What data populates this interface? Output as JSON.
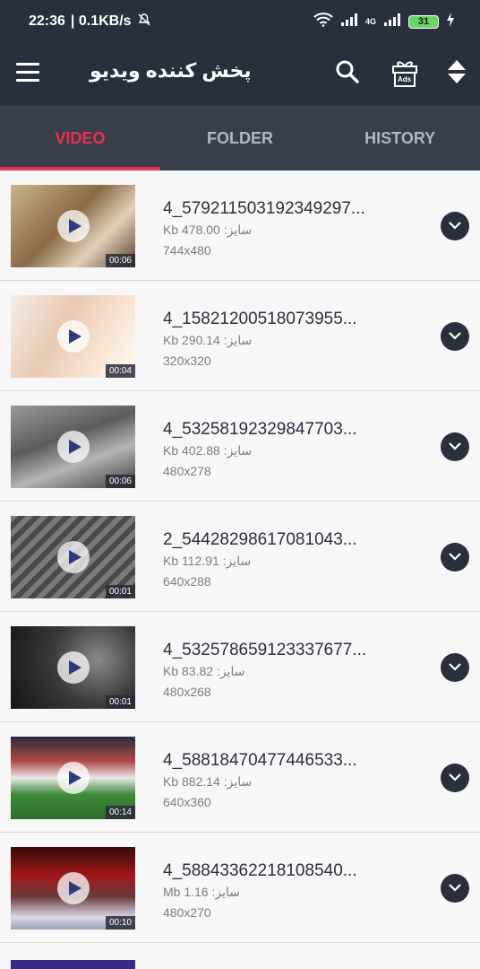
{
  "status_bar": {
    "time": "22:36",
    "speed": "| 0.1KB/s",
    "signal_label": "4G",
    "battery": "31"
  },
  "toolbar": {
    "title": "پخش کننده ویدیو",
    "ads_label": "Ads"
  },
  "tabs": [
    {
      "label": "VIDEO",
      "active": true
    },
    {
      "label": "FOLDER",
      "active": false
    },
    {
      "label": "HISTORY",
      "active": false
    }
  ],
  "videos": [
    {
      "name": "4_579211503192349297...",
      "size": "Kb 478.00 :سایز",
      "resolution": "744x480",
      "duration": "00:06"
    },
    {
      "name": "4_15821200518073955...",
      "size": "Kb 290.14 :سایز",
      "resolution": "320x320",
      "duration": "00:04"
    },
    {
      "name": "4_53258192329847703...",
      "size": "Kb 402.88 :سایز",
      "resolution": "480x278",
      "duration": "00:06"
    },
    {
      "name": "2_54428298617081043...",
      "size": "Kb 112.91 :سایز",
      "resolution": "640x288",
      "duration": "00:01"
    },
    {
      "name": "4_532578659123337677...",
      "size": "Kb 83.82 :سایز",
      "resolution": "480x268",
      "duration": "00:01"
    },
    {
      "name": "4_58818470477446533...",
      "size": "Kb 882.14 :سایز",
      "resolution": "640x360",
      "duration": "00:14"
    },
    {
      "name": "4_58843362218108540...",
      "size": "Mb 1.16 :سایز",
      "resolution": "480x270",
      "duration": "00:10"
    }
  ],
  "colors": {
    "header_bg": "#2b2f3d",
    "tab_bg": "#3a3e4c",
    "accent": "#e8314c"
  }
}
